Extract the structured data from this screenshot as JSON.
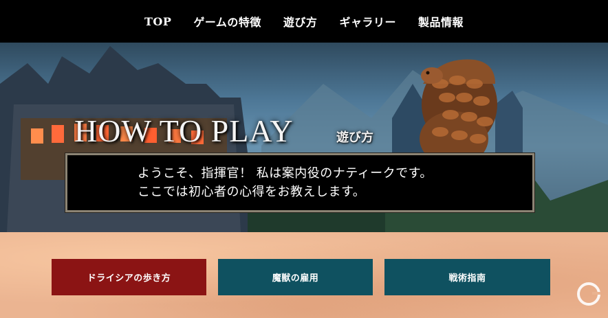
{
  "nav": {
    "items": [
      {
        "label": "TOP"
      },
      {
        "label": "ゲームの特徴"
      },
      {
        "label": "遊び方"
      },
      {
        "label": "ギャラリー"
      },
      {
        "label": "製品情報"
      }
    ]
  },
  "hero": {
    "title": "HOW TO PLAY",
    "subtitle": "遊び方",
    "message": {
      "line1": "ようこそ、指揮官！ 私は案内役のナティークです。",
      "line2": "ここでは初心者の心得をお教えします。"
    },
    "image_alt": "castle-town-with-armored-pangolin-guide"
  },
  "buttons": {
    "walk": "ドライシアの歩き方",
    "hire": "魔獣の雇用",
    "tactics": "戦術指南"
  },
  "colors": {
    "nav_bg": "#000000",
    "button_red": "#8b1414",
    "button_teal": "#0f5160",
    "parchment": "#ebb491"
  },
  "icons": [
    "site-logo-icon"
  ]
}
